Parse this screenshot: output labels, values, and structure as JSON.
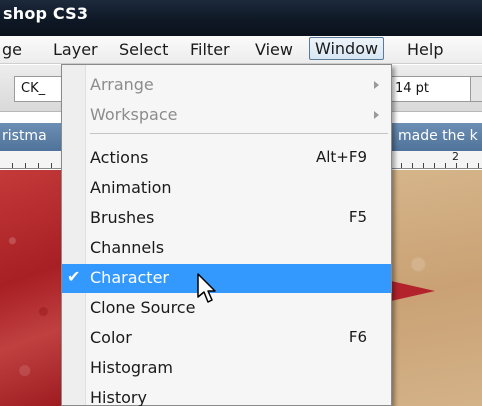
{
  "window": {
    "title": "shop CS3"
  },
  "menubar": {
    "items": [
      {
        "label": "ge"
      },
      {
        "label": "Layer"
      },
      {
        "label": "Select"
      },
      {
        "label": "Filter"
      },
      {
        "label": "View"
      },
      {
        "label": "Window",
        "active": true
      },
      {
        "label": "Help"
      }
    ]
  },
  "options": {
    "font_field_value": "CK_",
    "size_field_value": "14 pt"
  },
  "documents": {
    "left_tab_title": "ristma",
    "right_tab_title": "made the k"
  },
  "ruler": {
    "label": "2"
  },
  "window_menu": {
    "items": [
      {
        "label": "Arrange",
        "shortcut": "",
        "submenu": true,
        "disabled": true,
        "checked": false
      },
      {
        "label": "Workspace",
        "shortcut": "",
        "submenu": true,
        "disabled": true,
        "checked": false
      },
      {
        "label": "Actions",
        "shortcut": "Alt+F9",
        "submenu": false,
        "disabled": false,
        "checked": false
      },
      {
        "label": "Animation",
        "shortcut": "",
        "submenu": false,
        "disabled": false,
        "checked": false
      },
      {
        "label": "Brushes",
        "shortcut": "F5",
        "submenu": false,
        "disabled": false,
        "checked": false
      },
      {
        "label": "Channels",
        "shortcut": "",
        "submenu": false,
        "disabled": false,
        "checked": false
      },
      {
        "label": "Character",
        "shortcut": "",
        "submenu": false,
        "disabled": false,
        "checked": true,
        "highlighted": true
      },
      {
        "label": "Clone Source",
        "shortcut": "",
        "submenu": false,
        "disabled": false,
        "checked": false
      },
      {
        "label": "Color",
        "shortcut": "F6",
        "submenu": false,
        "disabled": false,
        "checked": false
      },
      {
        "label": "Histogram",
        "shortcut": "",
        "submenu": false,
        "disabled": false,
        "checked": false
      },
      {
        "label": "History",
        "shortcut": "",
        "submenu": false,
        "disabled": false,
        "checked": false
      }
    ],
    "check_glyph": "✔",
    "highlight_color": "#3399ff"
  },
  "icons": {
    "cursor": "arrow-cursor-icon",
    "submenu": "submenu-arrow-icon",
    "check": "checkmark-icon"
  }
}
